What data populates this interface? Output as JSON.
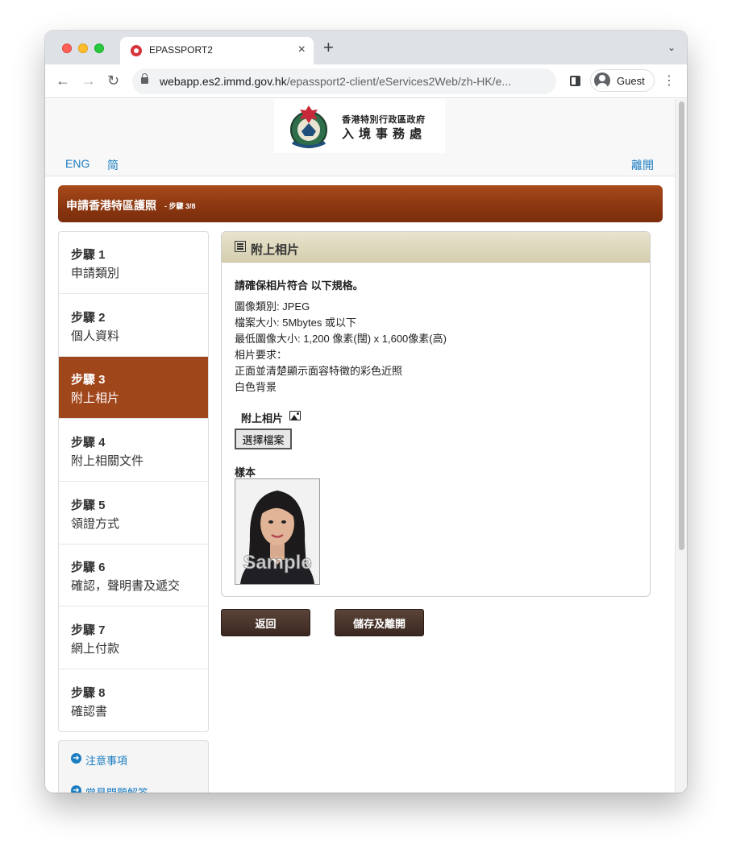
{
  "browser": {
    "tab_title": "EPASSPORT2",
    "tab_close": "×",
    "new_tab": "+",
    "tab_menu": "⌄",
    "url_host": "webapp.es2.immd.gov.hk",
    "url_path": "/epassport2-client/eServices2Web/zh-HK/e...",
    "profile_label": "Guest",
    "menu": "⋮",
    "nav": {
      "back": "←",
      "forward": "→",
      "reload": "↻"
    }
  },
  "header": {
    "logo_line1": "香港特別行政區政府",
    "logo_line2": "入境事務處",
    "lang_en": "ENG",
    "lang_sc": "简",
    "exit_label": "離開"
  },
  "banner": {
    "title": "申請香港特區護照",
    "step": "- 步驟 3/8"
  },
  "steps": [
    {
      "no": "步驟 1",
      "name": "申請類別",
      "active": false
    },
    {
      "no": "步驟 2",
      "name": "個人資料",
      "active": false
    },
    {
      "no": "步驟 3",
      "name": "附上相片",
      "active": true
    },
    {
      "no": "步驟 4",
      "name": "附上相關文件",
      "active": false
    },
    {
      "no": "步驟 5",
      "name": "領證方式",
      "active": false
    },
    {
      "no": "步驟 6",
      "name": "確認，聲明書及遞交",
      "active": false
    },
    {
      "no": "步驟 7",
      "name": "網上付款",
      "active": false
    },
    {
      "no": "步驟 8",
      "name": "確認書",
      "active": false
    }
  ],
  "side_links": [
    {
      "label": "注意事項",
      "arrow": "➜"
    },
    {
      "label": "常見問題解答",
      "arrow": "➜"
    }
  ],
  "panel": {
    "title": "附上相片",
    "requirements_heading": "請確保相片符合 以下規格。",
    "requirements": [
      "圖像類別: JPEG",
      "檔案大小: 5Mbytes 或以下",
      "最低圖像大小: 1,200 像素(闊) x 1,600像素(高)",
      "相片要求：",
      "正面並清楚顯示面容特徵的彩色近照",
      "白色背景"
    ],
    "attach_label": "附上相片",
    "choose_file": "選擇檔案",
    "sample_label": "樣本",
    "sample_watermark": "Sample"
  },
  "buttons": {
    "back": "返回",
    "save_exit": "儲存及離開"
  },
  "colors": {
    "banner": "#8c3710",
    "active_step": "#a0461b",
    "link": "#1a7cc1",
    "panel_header": "#ddd7bb",
    "button": "#4a3429"
  }
}
